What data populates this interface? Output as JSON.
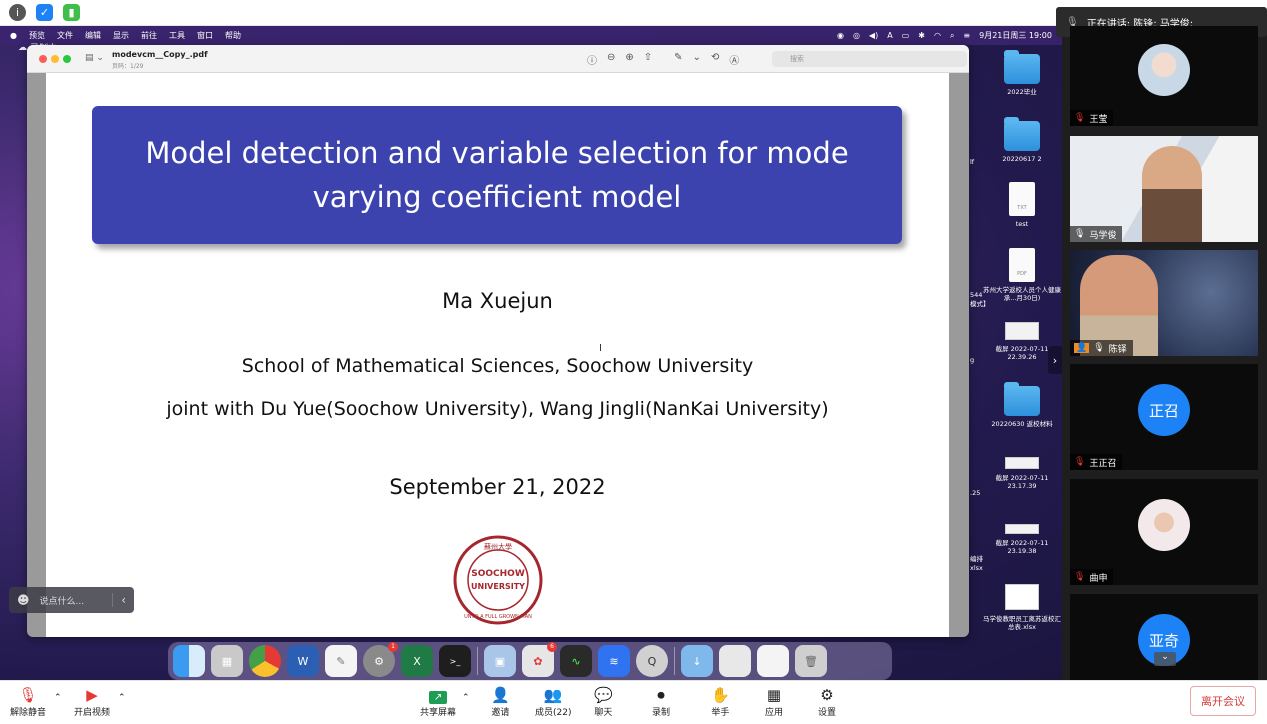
{
  "meeting": {
    "speaking_label": "正在讲话: 陈锋; 马学俊;",
    "leave_label": "离开会议"
  },
  "mac": {
    "menu": [
      "预览",
      "文件",
      "编辑",
      "显示",
      "前往",
      "工具",
      "窗口",
      "帮助"
    ],
    "clock": "9月21日周三 19:00",
    "recording": "录制中"
  },
  "preview": {
    "filename": "modevcm__Copy_.pdf",
    "page_info": "页码：1/29",
    "search_placeholder": "搜索"
  },
  "slide": {
    "title_line1": "Model detection and variable selection for mode",
    "title_line2": "varying coefficient model",
    "author": "Ma Xuejun",
    "affiliation": "School of Mathematical Sciences, Soochow University",
    "joint": "joint with Du Yue(Soochow University), Wang Jingli(NanKai University)",
    "date": "September 21, 2022",
    "seal_text_top": "蘇州大學",
    "seal_text_mid1": "SOOCHOW",
    "seal_text_mid2": "UNIVERSITY",
    "seal_text_bottom": "UNTO A FULL GROWN MAN"
  },
  "desktop": {
    "icons": [
      {
        "label": "2022毕业"
      },
      {
        "label": "20220617 2"
      },
      {
        "label": "test"
      },
      {
        "label": "苏州大学返校人员个人健康承...月30日)"
      },
      {
        "label": "截屏 2022-07-11 22.39.26"
      },
      {
        "label": "20220630 返校材料"
      },
      {
        "label": "截屏 2022-07-11 23.17.39"
      },
      {
        "label": "截屏 2022-07-11 23.19.38"
      },
      {
        "label": "马学俊教职员工离苏返校汇总表.xlsx"
      }
    ],
    "cut_labels": [
      "lf",
      "544",
      "模式】",
      "g",
      ".25",
      "编排",
      "xlsx"
    ],
    "doc_tag": "PDF",
    "doc_tag2": "TXT"
  },
  "dock": {
    "badges": {
      "settings": "1",
      "apps": "6"
    }
  },
  "chat": {
    "placeholder": "说点什么..."
  },
  "participants": [
    {
      "name": "王莹"
    },
    {
      "name": "马学俊"
    },
    {
      "name": "陈铎"
    },
    {
      "name": "王正召",
      "avatar_text": "正召",
      "color": "#1d82f5"
    },
    {
      "name": "曲申"
    },
    {
      "name": "亚奇",
      "avatar_text": "亚奇",
      "color": "#1d82f5"
    }
  ],
  "toolbar": {
    "mute": "解除静音",
    "video": "开启视频",
    "share": "共享屏幕",
    "invite": "邀请",
    "members": "成员(22)",
    "chat": "聊天",
    "record": "录制",
    "raise": "举手",
    "apps": "应用",
    "settings": "设置"
  }
}
